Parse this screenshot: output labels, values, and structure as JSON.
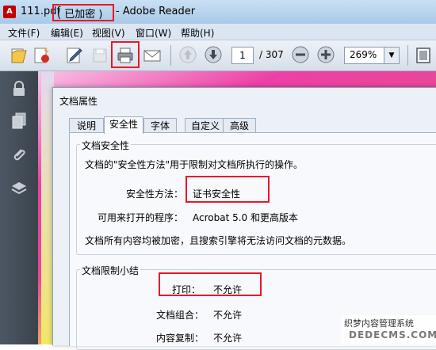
{
  "titlebar": {
    "filename": "111.pdf",
    "encrypted_tag": "( 已加密 )",
    "app_name": "- Adobe Reader"
  },
  "menu": [
    {
      "label": "文件(F)"
    },
    {
      "label": "编辑(E)"
    },
    {
      "label": "视图(V)"
    },
    {
      "label": "窗口(W)"
    },
    {
      "label": "帮助(H)"
    }
  ],
  "toolbar": {
    "current_page": "1",
    "total_pages": "/ 307",
    "zoom": "269%",
    "icons": [
      "open-icon",
      "create-pdf-icon",
      "sign-icon",
      "save-icon",
      "print-icon",
      "email-icon",
      "prev-page-icon",
      "next-page-icon",
      "zoom-out-icon",
      "zoom-in-icon",
      "fit-page-icon"
    ]
  },
  "leftpanel": {
    "icons": [
      "lock-icon",
      "pages-icon",
      "attachment-icon",
      "layers-icon"
    ]
  },
  "dialog": {
    "title": "文档属性",
    "tabs": [
      "说明",
      "安全性",
      "字体",
      "自定义",
      "高级"
    ],
    "active_tab": "安全性",
    "security_group": {
      "title": "文档安全性",
      "description": "文档的\"安全性方法\"用于限制对文档所执行的操作。",
      "method_label": "安全性方法：",
      "method_value": "证书安全性",
      "compat_label": "可用来打开的程序：",
      "compat_value": "Acrobat 5.0 和更高版本",
      "note": "文档所有内容均被加密，且搜索引擎将无法访问文档的元数据。"
    },
    "restrictions_group": {
      "title": "文档限制小结",
      "rows": [
        {
          "label": "打印：",
          "value": "不允许"
        },
        {
          "label": "文档组合：",
          "value": "不允许"
        },
        {
          "label": "内容复制：",
          "value": "不允许"
        }
      ]
    }
  },
  "watermark": {
    "line1": "织梦内容管理系统",
    "line2": "DEDECMS.COM"
  },
  "highlight_color": "#e8182a"
}
